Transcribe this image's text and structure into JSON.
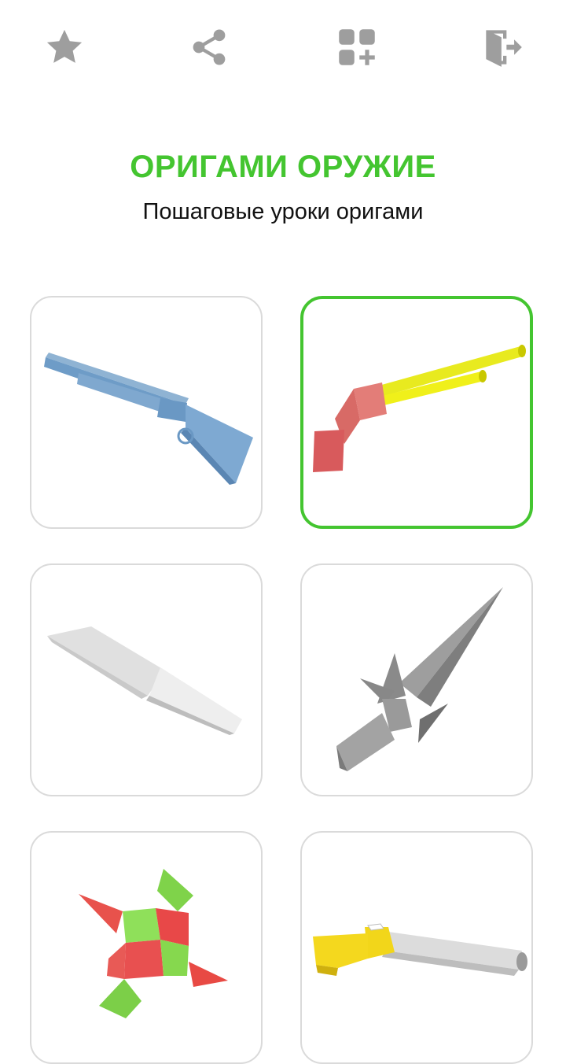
{
  "header": {
    "title": "ОРИГАМИ ОРУЖИЕ",
    "subtitle": "Пошаговые уроки оригами"
  },
  "toolbar": {
    "icons": [
      "star-icon",
      "share-icon",
      "more-apps-icon",
      "exit-icon"
    ]
  },
  "colors": {
    "accent": "#44c530",
    "icon_gray": "#9e9e9e",
    "card_border": "#dadada"
  },
  "grid": {
    "selected_index": 1,
    "items": [
      {
        "icon": "blue-rifle-image"
      },
      {
        "icon": "double-barrel-shotgun-image"
      },
      {
        "icon": "paper-knife-image"
      },
      {
        "icon": "paper-dagger-image"
      },
      {
        "icon": "ninja-star-image"
      },
      {
        "icon": "yellow-shotgun-image"
      }
    ]
  }
}
